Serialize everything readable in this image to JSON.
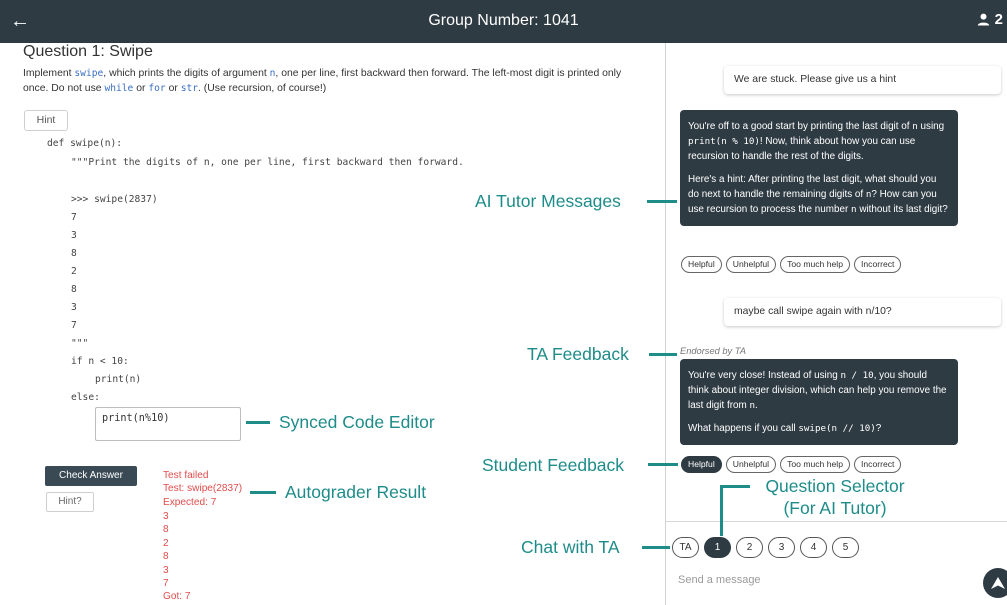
{
  "topbar": {
    "back_icon": "arrow-left-icon",
    "title": "Group Number: 1041",
    "user_count": "2",
    "user_icon": "person-icon"
  },
  "question": {
    "title": "Question 1: Swipe",
    "desc_1": "Implement ",
    "desc_swipe": "swipe",
    "desc_2": ", which prints the digits of argument ",
    "desc_n": "n",
    "desc_3": ", one per line, first backward then forward. The left-most digit is printed only once. Do not use ",
    "desc_while": "while",
    "desc_4": " or ",
    "desc_for": "for",
    "desc_5": " or ",
    "desc_str": "str",
    "desc_6": ". (Use recursion, of course!)",
    "hint_label": "Hint"
  },
  "code_lines": [
    "def swipe(n):",
    "\"\"\"Print the digits of n, one per line, first backward then forward.",
    ">>> swipe(2837)",
    "7",
    "3",
    "8",
    "2",
    "8",
    "3",
    "7",
    "\"\"\"",
    "if n < 10:",
    "print(n)",
    "else:"
  ],
  "editor": {
    "value": "print(n%10)"
  },
  "actions": {
    "check_answer": "Check Answer",
    "hint": "Hint?"
  },
  "result_lines": [
    "Test failed",
    "Test: swipe(2837)",
    "Expected: 7",
    "3",
    "8",
    "2",
    "8",
    "3",
    "7",
    "Got: 7"
  ],
  "chat": {
    "student_msg_1": "We are stuck. Please give us a hint",
    "tutor_msg_1": {
      "p1_a": "You're off to a good start by printing the last digit of ",
      "p1_code1": "n",
      "p1_b": " using ",
      "p1_code2": "print(n % 10)",
      "p1_c": "! Now, think about how you can use recursion to handle the rest of the digits.",
      "p2_a": "Here's a hint: After printing the last digit, what should you do next to handle the remaining digits of ",
      "p2_code1": "n",
      "p2_b": "? How can you use recursion to process the number ",
      "p2_code2": "n",
      "p2_c": " without its last digit?"
    },
    "feedback_labels": [
      "Helpful",
      "Unhelpful",
      "Too much help",
      "Incorrect"
    ],
    "student_msg_2": "maybe call swipe again with n/10?",
    "endorsed": "Endorsed by TA",
    "tutor_msg_2": {
      "p1_a": "You're very close! Instead of using ",
      "p1_code1": "n / 10",
      "p1_b": ", you should think about integer division, which can help you remove the last digit from ",
      "p1_code2": "n",
      "p1_c": ".",
      "p2_a": "What happens if you call ",
      "p2_code1": "swipe(n // 10)",
      "p2_b": "?"
    },
    "question_selector": [
      "TA",
      "1",
      "2",
      "3",
      "4",
      "5"
    ],
    "selected_question": "1",
    "input_placeholder": "Send a message",
    "send_icon": "send-arrow-icon"
  },
  "annotations": {
    "ai_tutor": "AI Tutor Messages",
    "ta_feedback": "TA Feedback",
    "student_feedback": "Student Feedback",
    "question_selector_1": "Question Selector",
    "question_selector_2": "(For AI Tutor)",
    "chat_with_ta": "Chat with TA",
    "code_editor": "Synced Code Editor",
    "autograder": "Autograder Result"
  },
  "colors": {
    "topbar": "#2f3b43",
    "annotation": "#1e8c89",
    "error": "#e34b4b",
    "keyword": "#3b6fc2"
  }
}
